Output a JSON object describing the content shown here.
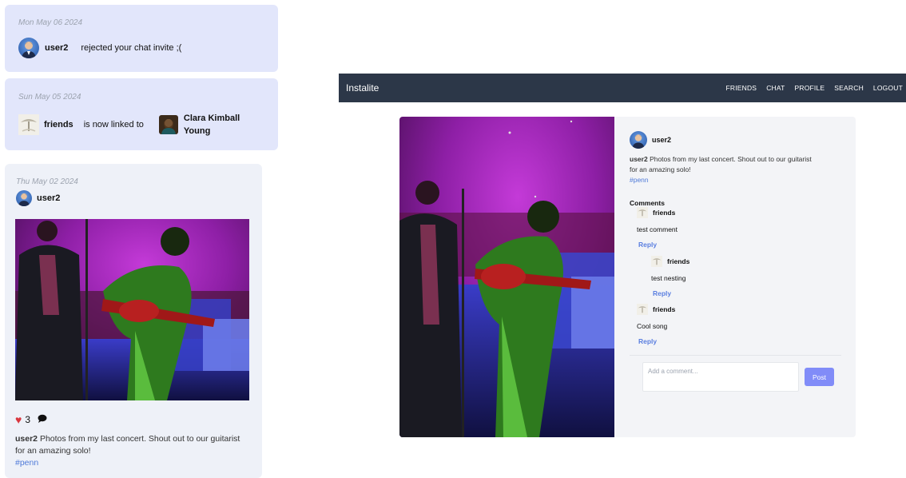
{
  "notifications": [
    {
      "date": "Mon May 06 2024",
      "user": "user2",
      "text": "rejected your chat invite ;("
    },
    {
      "date": "Sun May 05 2024",
      "user": "friends",
      "text": "is now linked to",
      "target": "Clara Kimball",
      "target_line2": "Young"
    }
  ],
  "feed_post": {
    "date": "Thu May 02 2024",
    "author": "user2",
    "likes": "3",
    "caption_author": "user2",
    "caption_line1": "Photos from my last concert. Shout out to our guitarist",
    "caption_line2": "for an amazing solo!",
    "hashtag": "#penn"
  },
  "navbar": {
    "brand": "Instalite",
    "links": [
      "FRIENDS",
      "CHAT",
      "PROFILE",
      "SEARCH",
      "LOGOUT"
    ]
  },
  "post_detail": {
    "author": "user2",
    "caption_author": "user2",
    "caption_line1": "Photos from my last concert. Shout out to our guitarist",
    "caption_line2": "for an amazing solo!",
    "hashtag": "#penn",
    "comments_title": "Comments",
    "comments": [
      {
        "author": "friends",
        "text": "test comment",
        "reply": "Reply"
      },
      {
        "author": "friends",
        "text": "test nesting",
        "reply": "Reply"
      },
      {
        "author": "friends",
        "text": "Cool song",
        "reply": "Reply"
      }
    ],
    "comment_placeholder": "Add a comment...",
    "post_button": "Post"
  },
  "colors": {
    "navbar": "#2c3748",
    "notification_bg": "#e2e6fb",
    "card_bg": "#eef1f8",
    "link": "#5b7fe0",
    "post_button": "#818cf8",
    "like": "#d9363e"
  }
}
